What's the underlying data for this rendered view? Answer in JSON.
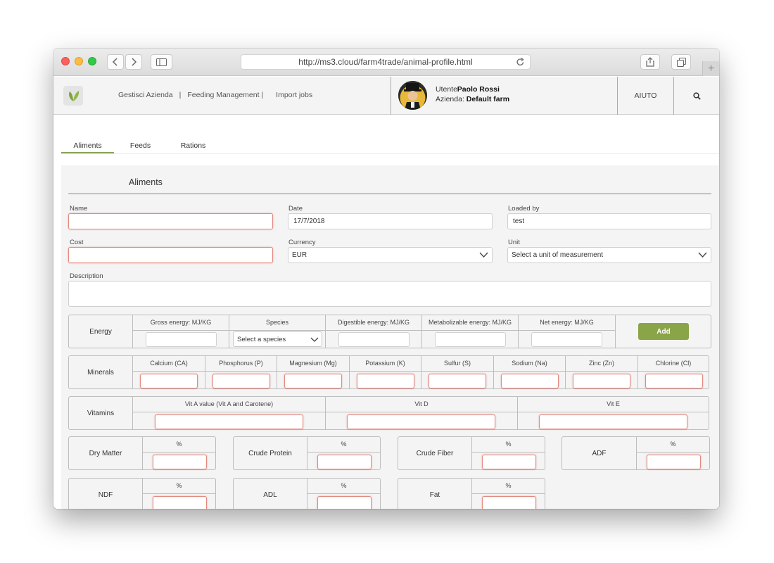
{
  "browser": {
    "url": "http://ms3.cloud/farm4trade/animal-profile.html",
    "new_tab": "+"
  },
  "header": {
    "nav": [
      "Gestisci Azienda",
      "|",
      "Feeding Management |",
      "Import jobs"
    ],
    "user_label": "Utente:",
    "user_name": "Paolo Rossi",
    "company_label": "Azienda:",
    "company_name": "Default farm",
    "help": "AIUTO"
  },
  "tabs": [
    "Aliments",
    "Feeds",
    "Rations"
  ],
  "form": {
    "title": "Aliments",
    "name_label": "Name",
    "date_label": "Date",
    "date_value": "17/7/2018",
    "loaded_by_label": "Loaded by",
    "loaded_by_value": "test",
    "cost_label": "Cost",
    "currency_label": "Currency",
    "currency_value": "EUR",
    "unit_label": "Unit",
    "unit_placeholder": "Select a unit of measurement",
    "description_label": "Description"
  },
  "energy": {
    "label": "Energy",
    "columns": [
      "Gross energy: MJ/KG",
      "Species",
      "Digestible energy: MJ/KG",
      "Metabolizable energy: MJ/KG",
      "Net energy: MJ/KG"
    ],
    "species_placeholder": "Select a species",
    "add_button": "Add"
  },
  "minerals": {
    "label": "Minerals",
    "columns": [
      "Calcium (CA)",
      "Phosphorus (P)",
      "Magnesium (Mg)",
      "Potassium (K)",
      "Sulfur (S)",
      "Sodium (Na)",
      "Zinc (Zn)",
      "Chlorine (Cl)"
    ]
  },
  "vitamins": {
    "label": "Vitamins",
    "columns": [
      "Vit A value (Vit A and Carotene)",
      "Vit D",
      "Vit E"
    ]
  },
  "composition": [
    {
      "label": "Dry Matter",
      "unit": "%"
    },
    {
      "label": "Crude Protein",
      "unit": "%"
    },
    {
      "label": "Crude Fiber",
      "unit": "%"
    },
    {
      "label": "ADF",
      "unit": "%"
    },
    {
      "label": "NDF",
      "unit": "%"
    },
    {
      "label": "ADL",
      "unit": "%"
    },
    {
      "label": "Fat",
      "unit": "%"
    }
  ],
  "colors": {
    "accent": "#8aa448",
    "error_border": "#e38a80"
  }
}
